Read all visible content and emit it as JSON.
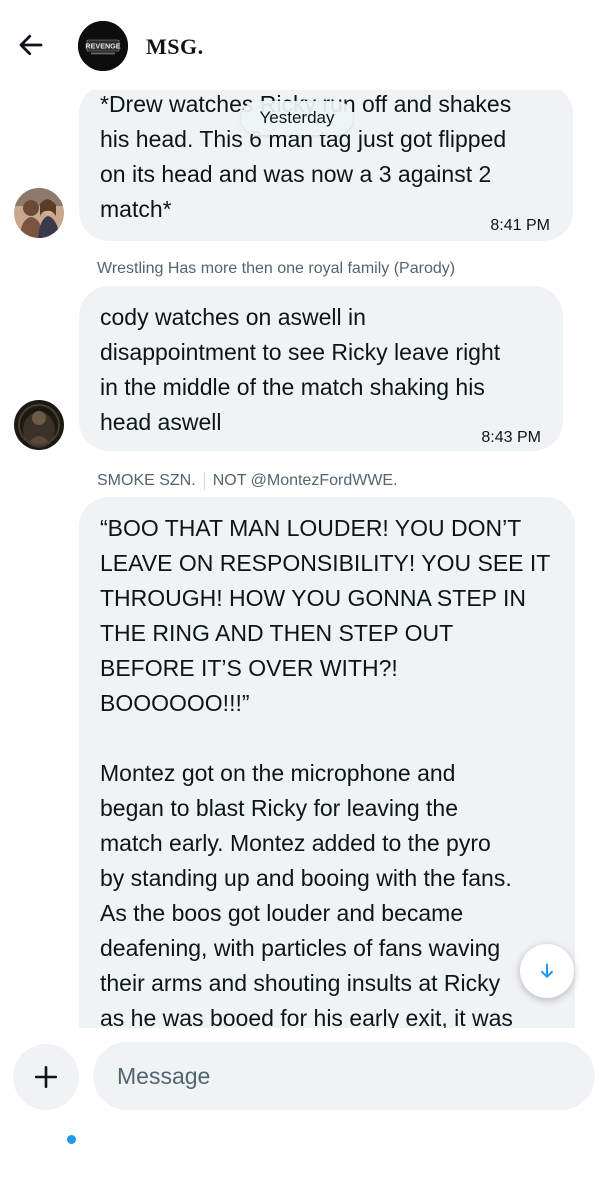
{
  "header": {
    "title": "MSG.",
    "avatar_text": "REVENGE",
    "back_icon": "arrow-left-icon"
  },
  "date_pill": "Yesterday",
  "messages": [
    {
      "text": "*Drew watches Ricky run off and shakes\nhis head. This 6 man tag just got flipped\non its head and was now a 3 against 2\nmatch*",
      "time": "8:41 PM"
    },
    {
      "sender": "Wrestling Has more then one royal family (Parody)",
      "text": "cody watches on aswell in\ndisappointment to see Ricky leave right\nin the middle of the match shaking his\nhead aswell",
      "time": "8:43 PM"
    },
    {
      "sender_name": "SMOKE SZN.",
      "sender_tag": "NOT @MontezFordWWE.",
      "text": "“BOO THAT MAN LOUDER! YOU DON’T\nLEAVE ON RESPONSIBILITY! YOU SEE IT\nTHROUGH! HOW YOU GONNA STEP IN\nTHE RING AND THEN STEP OUT\nBEFORE IT’S OVER WITH?!\nBOOOOOO!!!”\n\nMontez got on the microphone and\nbegan to blast Ricky for leaving the\nmatch early. Montez added to the pyro\nby standing up and booing with the fans.\nAs the boos got louder and became\ndeafening, with particles of fans waving\ntheir arms and shouting insults at Ricky\nas he was booed for his early exit, it was"
    }
  ],
  "composer": {
    "placeholder": "Message",
    "add_icon": "plus-icon"
  },
  "nav": [
    "home-icon",
    "search-icon",
    "grok-icon",
    "notifications-icon",
    "messages-icon"
  ],
  "colors": {
    "bubble": "#eff3f4",
    "accent": "#1d9bf0",
    "secondary_text": "#536471"
  }
}
